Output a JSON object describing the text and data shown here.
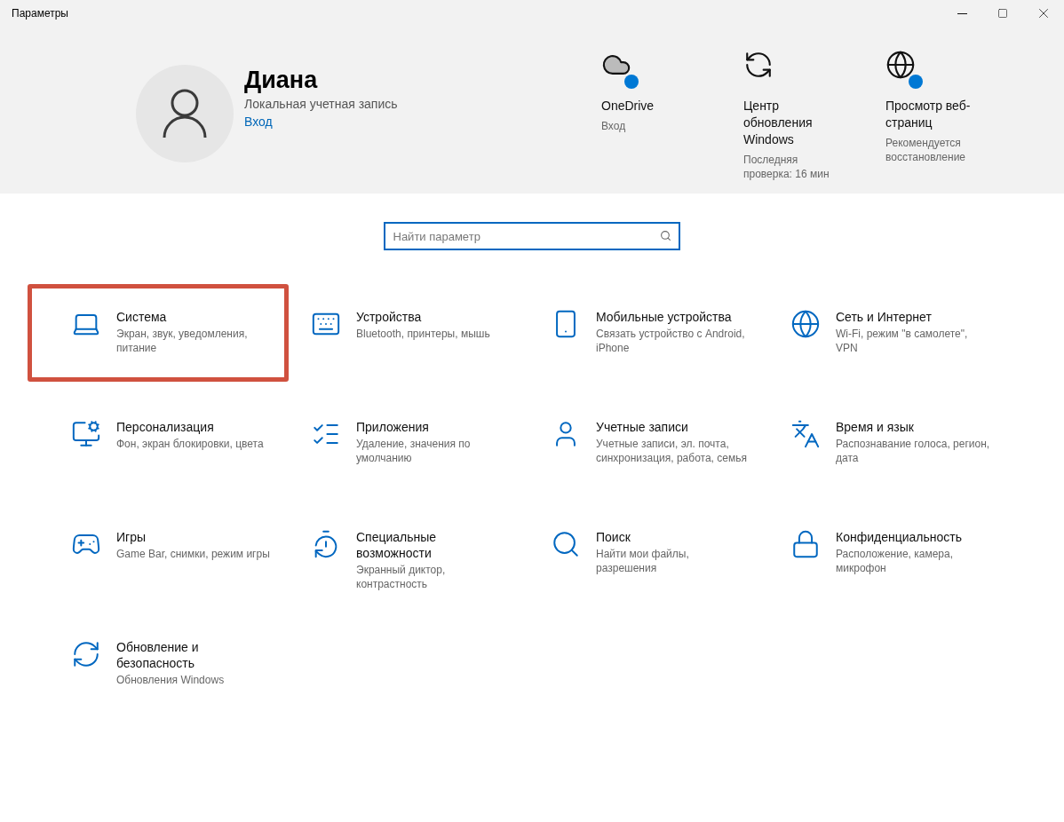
{
  "window": {
    "title": "Параметры"
  },
  "account": {
    "name": "Диана",
    "type": "Локальная учетная запись",
    "link": "Вход"
  },
  "quick_tiles": [
    {
      "kind": "onedrive",
      "title": "OneDrive",
      "subtitle": "Вход",
      "badge": true
    },
    {
      "kind": "update",
      "title": "Центр обновления Windows",
      "subtitle": "Последняя проверка: 16 мин",
      "badge": false
    },
    {
      "kind": "browser",
      "title": "Просмотр веб-страниц",
      "subtitle": "Рекомендуется восстановление",
      "badge": true
    }
  ],
  "search": {
    "placeholder": "Найти параметр"
  },
  "categories": [
    {
      "kind": "system",
      "title": "Система",
      "description": "Экран, звук, уведомления, питание",
      "highlighted": true
    },
    {
      "kind": "devices",
      "title": "Устройства",
      "description": "Bluetooth, принтеры, мышь",
      "highlighted": false
    },
    {
      "kind": "phone",
      "title": "Мобильные устройства",
      "description": "Связать устройство с Android, iPhone",
      "highlighted": false
    },
    {
      "kind": "network",
      "title": "Сеть и Интернет",
      "description": "Wi-Fi, режим \"в самолете\", VPN",
      "highlighted": false
    },
    {
      "kind": "personalization",
      "title": "Персонализация",
      "description": "Фон, экран блокировки, цвета",
      "highlighted": false
    },
    {
      "kind": "apps",
      "title": "Приложения",
      "description": "Удаление, значения по умолчанию",
      "highlighted": false
    },
    {
      "kind": "accounts",
      "title": "Учетные записи",
      "description": "Учетные записи, эл. почта, синхронизация, работа, семья",
      "highlighted": false
    },
    {
      "kind": "time",
      "title": "Время и язык",
      "description": "Распознавание голоса, регион, дата",
      "highlighted": false
    },
    {
      "kind": "gaming",
      "title": "Игры",
      "description": "Game Bar, снимки, режим игры",
      "highlighted": false
    },
    {
      "kind": "accessibility",
      "title": "Специальные возможности",
      "description": "Экранный диктор, контрастность",
      "highlighted": false
    },
    {
      "kind": "search",
      "title": "Поиск",
      "description": "Найти мои файлы, разрешения",
      "highlighted": false
    },
    {
      "kind": "privacy",
      "title": "Конфиденциальность",
      "description": "Расположение, камера, микрофон",
      "highlighted": false
    },
    {
      "kind": "update",
      "title": "Обновление и безопасность",
      "description": "Обновления Windows",
      "highlighted": false
    }
  ]
}
